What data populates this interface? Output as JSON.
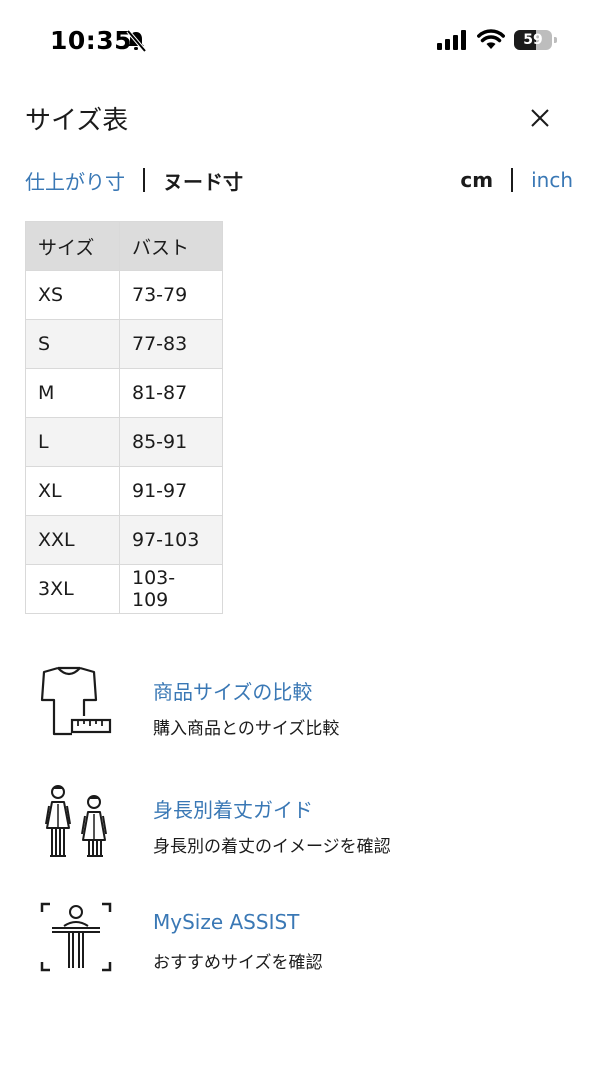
{
  "status_bar": {
    "time": "10:35",
    "battery_level": "59",
    "battery_fraction": 0.59,
    "icons": [
      "bell-slash-icon",
      "signal-icon",
      "wifi-icon",
      "battery-icon"
    ]
  },
  "modal": {
    "title": "サイズ表",
    "close_icon": "close-icon"
  },
  "measure_toggle": {
    "finished": "仕上がり寸",
    "nude": "ヌード寸",
    "selected": "nude"
  },
  "unit_toggle": {
    "cm": "cm",
    "inch": "inch",
    "selected": "cm"
  },
  "size_table": {
    "headers": [
      "サイズ",
      "バスト"
    ],
    "rows": [
      [
        "XS",
        "73-79"
      ],
      [
        "S",
        "77-83"
      ],
      [
        "M",
        "81-87"
      ],
      [
        "L",
        "85-91"
      ],
      [
        "XL",
        "91-97"
      ],
      [
        "XXL",
        "97-103"
      ],
      [
        "3XL",
        "103-109"
      ]
    ]
  },
  "links": [
    {
      "title": "商品サイズの比較",
      "subtitle": "購入商品とのサイズ比較",
      "icon": "tshirt-ruler-icon"
    },
    {
      "title": "身長別着丈ガイド",
      "subtitle": "身長別の着丈のイメージを確認",
      "icon": "people-height-icon"
    },
    {
      "title": "MySize ASSIST",
      "subtitle": "おすすめサイズを確認",
      "icon": "body-scan-icon"
    }
  ],
  "colors": {
    "link_blue": "#3a78b5",
    "text": "#1b1b1b",
    "header_gray": "#dcdcdc",
    "row_alt": "#f3f3f3"
  }
}
